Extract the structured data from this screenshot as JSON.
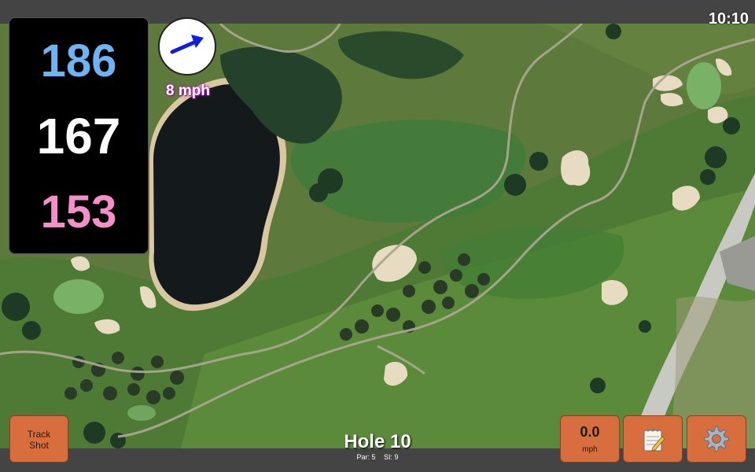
{
  "status": {
    "time": "10:10"
  },
  "distances": {
    "back": "186",
    "middle": "167",
    "front": "153"
  },
  "wind": {
    "speed_label": "8 mph",
    "icon": "wind-direction-arrow-icon"
  },
  "buttons": {
    "track_shot": "Track\nShot",
    "speed_value": "0.0",
    "speed_unit": "mph",
    "notes_icon": "notepad-icon",
    "settings_icon": "gear-icon"
  },
  "hole": {
    "title": "Hole 10",
    "par": "Par: 5",
    "si": "SI: 9"
  },
  "colors": {
    "back_distance": "#6fb4f2",
    "middle_distance": "#ffffff",
    "front_distance": "#f48fca",
    "button": "#d86e3d",
    "wind_label_glow": "#b01ab0"
  }
}
